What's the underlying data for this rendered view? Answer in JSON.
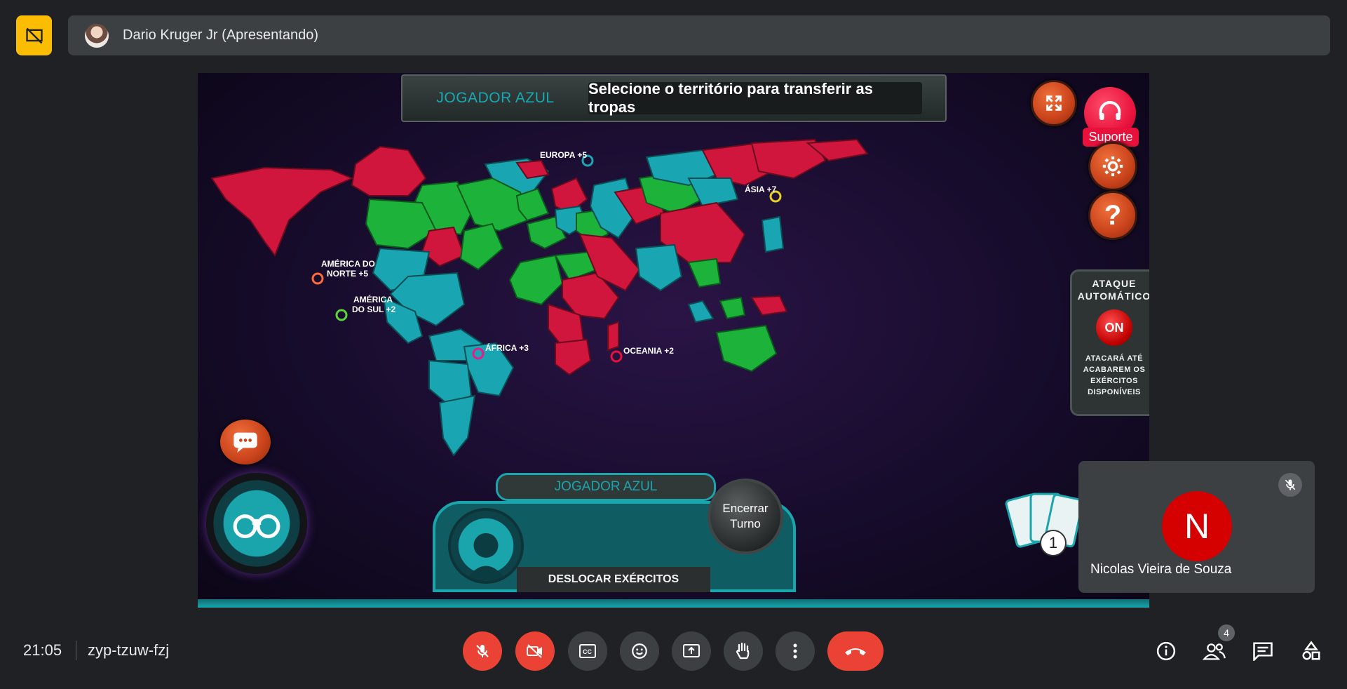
{
  "presenter": {
    "name": "Dario Kruger Jr (Apresentando)"
  },
  "game": {
    "banner_player": "JOGADOR AZUL",
    "banner_message": "Selecione o território para transferir as tropas",
    "support_label": "Suporte",
    "auto_attack": {
      "title_line1": "ATAQUE",
      "title_line2": "AUTOMÁTICO",
      "toggle": "ON",
      "desc": "ATACARÁ ATÉ ACABAREM OS EXÉRCITOS DISPONÍVEIS"
    },
    "regions": {
      "europa": "EUROPA +5",
      "asia": "ÁSIA +7",
      "america_norte_1": "AMÉRICA DO",
      "america_norte_2": "NORTE +5",
      "america_sul_1": "AMÉRICA",
      "america_sul_2": "DO SUL +2",
      "africa": "ÁFRICA +3",
      "oceania": "OCEANIA +2"
    },
    "console": {
      "player_name": "JOGADOR AZUL",
      "phase": "DESLOCAR EXÉRCITOS",
      "end_turn_1": "Encerrar",
      "end_turn_2": "Turno",
      "new_card_count": "1",
      "cards_count": "1"
    },
    "colors": {
      "blue": "#1aa5b2",
      "red": "#d0163c",
      "green": "#1db33a"
    }
  },
  "participant": {
    "initial": "N",
    "name": "Nicolas Vieira de Souza"
  },
  "meeting": {
    "time": "21:05",
    "code": "zyp-tzuw-fzj",
    "people_count": "4"
  },
  "icons": [
    "present-off-icon",
    "close-fullscreen-icon",
    "headset-icon",
    "gear-icon",
    "help-icon",
    "chat-icon",
    "binoculars-icon",
    "mic-off-icon",
    "cam-off-icon",
    "captions-icon",
    "emoji-icon",
    "present-icon",
    "raise-hand-icon",
    "more-icon",
    "leave-call-icon",
    "info-icon",
    "people-icon",
    "messages-icon",
    "activities-icon"
  ]
}
